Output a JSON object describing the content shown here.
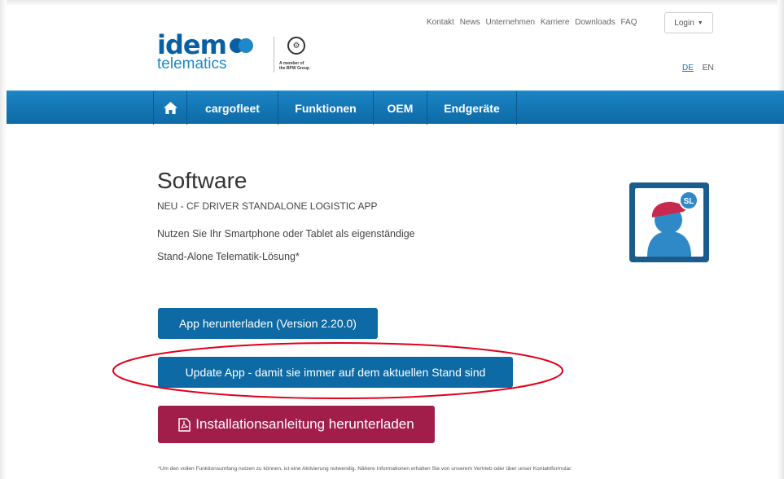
{
  "top_nav": {
    "links": [
      "Kontakt",
      "News",
      "Unternehmen",
      "Karriere",
      "Downloads",
      "FAQ"
    ],
    "login_label": "Login"
  },
  "language": {
    "de": "DE",
    "en": "EN"
  },
  "logo": {
    "brand": "idem",
    "sub": "telematics",
    "member_line1": "A member of",
    "member_line2": "the BPW Group"
  },
  "main_nav": {
    "home_icon": "home-icon",
    "items": [
      "cargofleet",
      "Funktionen",
      "OEM",
      "Endgeräte"
    ]
  },
  "content": {
    "title": "Software",
    "subtitle": "NEU - CF DRIVER STANDALONE LOGISTIC APP",
    "desc_line1": "Nutzen Sie Ihr Smartphone oder Tablet als eigenständige",
    "desc_line2": "Stand-Alone Telematik-Lösung*",
    "app_icon_badge": "SL"
  },
  "buttons": {
    "download": "App herunterladen (Version 2.20.0)",
    "update": "Update App - damit sie immer auf dem aktuellen Stand sind",
    "install": "Installationsanleitung herunterladen"
  },
  "footnote": "*Um den vollen Funktionsumfang nutzen zu können, ist eine Aktivierung notwendig. Nähere Informationen erhalten Sie von unserem Vertrieb oder über unser Kontaktformular.",
  "colors": {
    "primary": "#0d6aa4",
    "nav": "#1a84c4",
    "install": "#a21e4a",
    "annotation": "#e2001a"
  }
}
